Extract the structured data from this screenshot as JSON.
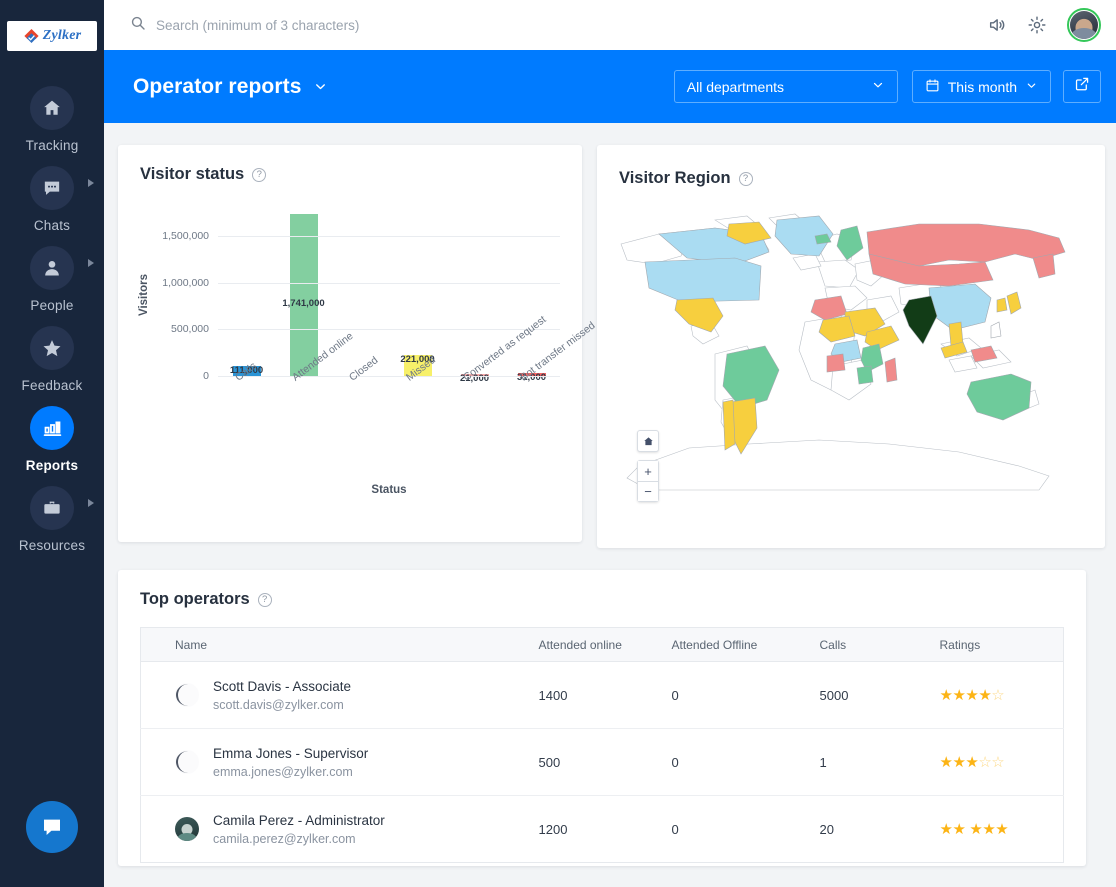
{
  "brand": {
    "name": "Zylker",
    "logo_icon": "zylker-diamond-icon"
  },
  "sidebar": {
    "items": [
      {
        "label": "Tracking",
        "icon": "home-icon",
        "active": false,
        "has_arrow": false
      },
      {
        "label": "Chats",
        "icon": "chat-icon",
        "active": false,
        "has_arrow": true
      },
      {
        "label": "People",
        "icon": "person-icon",
        "active": false,
        "has_arrow": true
      },
      {
        "label": "Feedback",
        "icon": "star-icon",
        "active": false,
        "has_arrow": false
      },
      {
        "label": "Reports",
        "icon": "bar-chart-icon",
        "active": true,
        "has_arrow": false
      },
      {
        "label": "Resources",
        "icon": "briefcase-icon",
        "active": false,
        "has_arrow": true
      }
    ],
    "chat_fab_icon": "chat-bubble-icon"
  },
  "topbar": {
    "search_placeholder": "Search (minimum of 3 characters)",
    "search_value": "",
    "search_icon": "search-icon",
    "sound_icon": "speaker-icon",
    "settings_icon": "gear-icon",
    "avatar_icon": "user-avatar"
  },
  "pageheader": {
    "title": "Operator reports",
    "title_caret_icon": "chevron-down-icon",
    "department_filter": "All departments",
    "department_caret_icon": "chevron-down-icon",
    "date_filter": "This month",
    "date_icon": "calendar-icon",
    "date_caret_icon": "chevron-down-icon",
    "export_icon": "external-link-icon",
    "accent_color": "#007bff"
  },
  "visitor_status": {
    "title": "Visitor status",
    "help_icon": "help-icon",
    "help_glyph": "?"
  },
  "visitor_region": {
    "title": "Visitor Region",
    "help_icon": "help-icon",
    "help_glyph": "?",
    "controls": {
      "home": "⌂",
      "zoom_in": "+",
      "zoom_out": "−"
    }
  },
  "top_operators": {
    "title": "Top operators",
    "help_icon": "help-icon",
    "help_glyph": "?",
    "columns": [
      "Name",
      "Attended online",
      "Attended Offline",
      "Calls",
      "Ratings"
    ],
    "rows": [
      {
        "name": "Scott Davis - Associate",
        "email": "scott.davis@zylker.com",
        "avatar": "faint",
        "attended_online": "1400",
        "attended_offline": "0",
        "calls": "5000",
        "rating_filled": 4,
        "rating_total": 5,
        "rating_gap_after": 0
      },
      {
        "name": "Emma Jones - Supervisor",
        "email": "emma.jones@zylker.com",
        "avatar": "faint",
        "attended_online": "500",
        "attended_offline": "0",
        "calls": "1",
        "rating_filled": 3,
        "rating_total": 5,
        "rating_gap_after": 0
      },
      {
        "name": "Camila Perez - Administrator",
        "email": "camila.perez@zylker.com",
        "avatar": "photo",
        "attended_online": "1200",
        "attended_offline": "0",
        "calls": "20",
        "rating_filled": 5,
        "rating_total": 5,
        "rating_gap_after": 2
      }
    ]
  },
  "chart_data": {
    "type": "bar",
    "title": "Visitor status",
    "xlabel": "Status",
    "ylabel": "Visitors",
    "ylim": [
      0,
      1800000
    ],
    "yticks": [
      0,
      500000,
      1000000,
      1500000
    ],
    "ytick_labels": [
      "0",
      "500,000",
      "1,000,000",
      "1,500,000"
    ],
    "grid": true,
    "legend": "none",
    "categories": [
      "Calls",
      "Attended online",
      "Closed",
      "Missed",
      "Converted as request",
      "Bot transfer missed"
    ],
    "values": [
      111000,
      1741000,
      0,
      221000,
      21000,
      31000
    ],
    "value_labels": [
      "111,000",
      "1,741,000",
      "",
      "221,000",
      "21,000",
      "31,000"
    ],
    "colors": [
      "#2a94d6",
      "#83cfa0",
      "#cccccc",
      "#f7f06a",
      "#f5a8a8",
      "#f56565"
    ]
  },
  "region_map": {
    "type": "choropleth",
    "regions": [
      {
        "name": "United States",
        "color": "#aadcf2"
      },
      {
        "name": "Canada",
        "color": "#aadcf2"
      },
      {
        "name": "Greenland",
        "color": "#aadcf2"
      },
      {
        "name": "Mexico",
        "color": "#f7cf3e"
      },
      {
        "name": "Brazil",
        "color": "#6ecb9b"
      },
      {
        "name": "Argentina",
        "color": "#f7cf3e"
      },
      {
        "name": "Chile",
        "color": "#f7cf3e"
      },
      {
        "name": "Russia",
        "color": "#f08b8b"
      },
      {
        "name": "China",
        "color": "#aadcf2"
      },
      {
        "name": "India",
        "color": "#123c17"
      },
      {
        "name": "Australia",
        "color": "#6ecb9b"
      },
      {
        "name": "Norway",
        "color": "#6ecb9b"
      },
      {
        "name": "Algeria",
        "color": "#f08b8b"
      },
      {
        "name": "Sudan",
        "color": "#f7cf3e"
      },
      {
        "name": "Ethiopia",
        "color": "#f7cf3e"
      },
      {
        "name": "Kenya",
        "color": "#6ecb9b"
      },
      {
        "name": "DR Congo",
        "color": "#aadcf2"
      },
      {
        "name": "Madagascar",
        "color": "#f08b8b"
      },
      {
        "name": "Indonesia",
        "color": "#f08b8b"
      },
      {
        "name": "Japan",
        "color": "#f7cf3e"
      },
      {
        "name": "Thailand",
        "color": "#f7cf3e"
      },
      {
        "name": "Nunavut",
        "color": "#f7cf3e"
      }
    ]
  }
}
